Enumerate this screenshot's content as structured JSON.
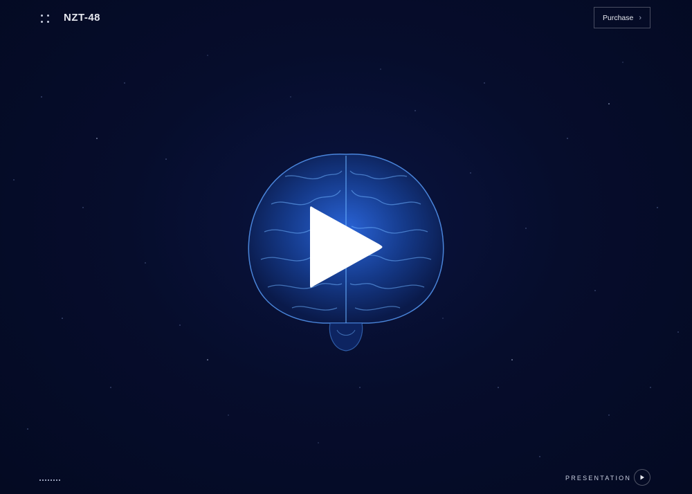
{
  "header": {
    "logo_text": "NZT-48",
    "menu_icon": "grid-dots-icon",
    "purchase_label": "Purchase",
    "purchase_icon": "chevron-right-icon"
  },
  "hero": {
    "image": "brain-illustration",
    "play_icon": "play-icon"
  },
  "footer": {
    "loader_icon": "dotted-loader-icon",
    "presentation_label": "PRESENTATION",
    "presentation_icon": "play-circle-icon"
  },
  "colors": {
    "background": "#050b26",
    "brain": "#2b6fd6",
    "text": "#e6e8ef"
  }
}
